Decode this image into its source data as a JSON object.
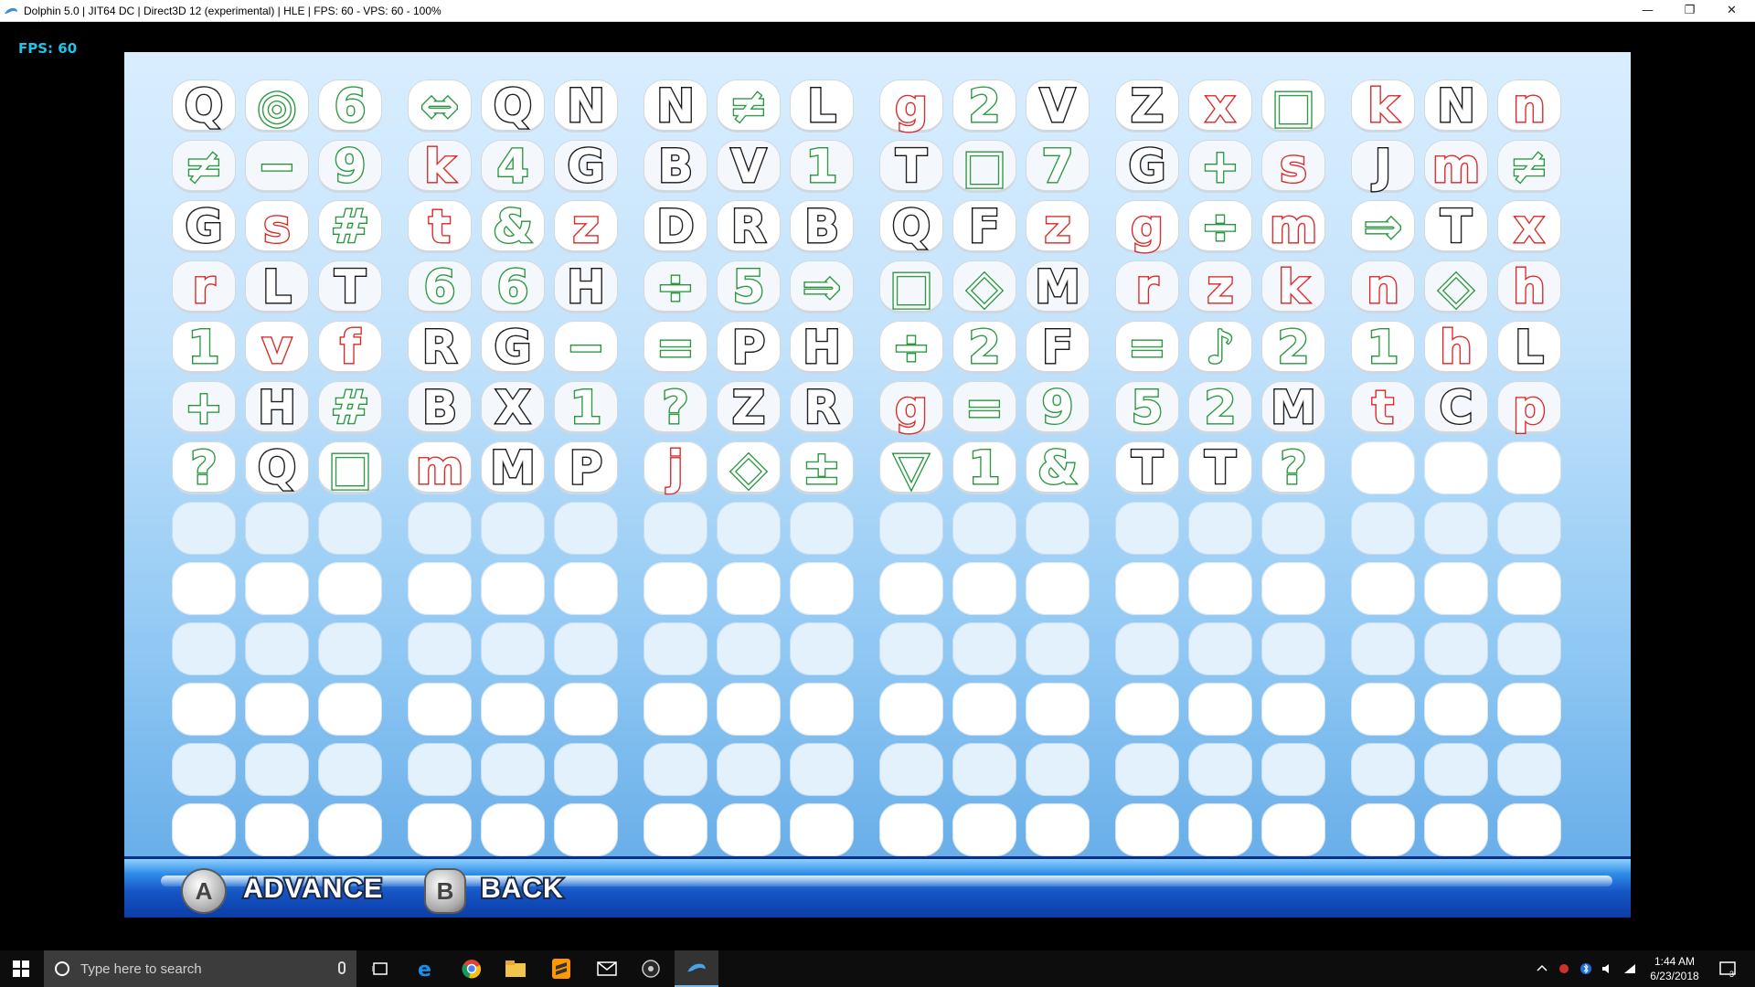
{
  "window": {
    "title": "Dolphin 5.0 | JIT64 DC | Direct3D 12 (experimental) | HLE | FPS: 60 - VPS: 60 - 100%",
    "min_glyph": "—",
    "max_glyph": "❐",
    "close_glyph": "✕"
  },
  "overlay": {
    "fps": "FPS: 60"
  },
  "grid": {
    "rows": [
      [
        [
          "Q",
          "k"
        ],
        [
          "◎",
          "g"
        ],
        [
          "6",
          "g"
        ],
        [
          "⇔",
          "g"
        ],
        [
          "Q",
          "k"
        ],
        [
          "N",
          "k"
        ],
        [
          "N",
          "k"
        ],
        [
          "≠",
          "g"
        ],
        [
          "L",
          "k"
        ],
        [
          "g",
          "r"
        ],
        [
          "2",
          "g"
        ],
        [
          "V",
          "k"
        ],
        [
          "Z",
          "k"
        ],
        [
          "x",
          "r"
        ],
        [
          "□",
          "g"
        ],
        [
          "k",
          "r"
        ],
        [
          "N",
          "k"
        ],
        [
          "n",
          "r"
        ]
      ],
      [
        [
          "≠",
          "g"
        ],
        [
          "−",
          "g"
        ],
        [
          "9",
          "g"
        ],
        [
          "k",
          "r"
        ],
        [
          "4",
          "g"
        ],
        [
          "G",
          "k"
        ],
        [
          "B",
          "k"
        ],
        [
          "V",
          "k"
        ],
        [
          "1",
          "g"
        ],
        [
          "T",
          "k"
        ],
        [
          "□",
          "g"
        ],
        [
          "7",
          "g"
        ],
        [
          "G",
          "k"
        ],
        [
          "+",
          "g"
        ],
        [
          "s",
          "r"
        ],
        [
          "J",
          "k"
        ],
        [
          "m",
          "r"
        ],
        [
          "≠",
          "g"
        ]
      ],
      [
        [
          "G",
          "k"
        ],
        [
          "s",
          "r"
        ],
        [
          "#",
          "g"
        ],
        [
          "t",
          "r"
        ],
        [
          "&",
          "g"
        ],
        [
          "z",
          "r"
        ],
        [
          "D",
          "k"
        ],
        [
          "R",
          "k"
        ],
        [
          "B",
          "k"
        ],
        [
          "Q",
          "k"
        ],
        [
          "F",
          "k"
        ],
        [
          "z",
          "r"
        ],
        [
          "g",
          "r"
        ],
        [
          "÷",
          "g"
        ],
        [
          "m",
          "r"
        ],
        [
          "⇒",
          "g"
        ],
        [
          "T",
          "k"
        ],
        [
          "x",
          "r"
        ]
      ],
      [
        [
          "r",
          "r"
        ],
        [
          "L",
          "k"
        ],
        [
          "T",
          "k"
        ],
        [
          "6",
          "g"
        ],
        [
          "6",
          "g"
        ],
        [
          "H",
          "k"
        ],
        [
          "÷",
          "g"
        ],
        [
          "5",
          "g"
        ],
        [
          "⇒",
          "g"
        ],
        [
          "□",
          "g"
        ],
        [
          "◇",
          "g"
        ],
        [
          "M",
          "k"
        ],
        [
          "r",
          "r"
        ],
        [
          "z",
          "r"
        ],
        [
          "k",
          "r"
        ],
        [
          "n",
          "r"
        ],
        [
          "◇",
          "g"
        ],
        [
          "h",
          "r"
        ]
      ],
      [
        [
          "1",
          "g"
        ],
        [
          "v",
          "r"
        ],
        [
          "f",
          "r"
        ],
        [
          "R",
          "k"
        ],
        [
          "G",
          "k"
        ],
        [
          "−",
          "g"
        ],
        [
          "=",
          "g"
        ],
        [
          "P",
          "k"
        ],
        [
          "H",
          "k"
        ],
        [
          "÷",
          "g"
        ],
        [
          "2",
          "g"
        ],
        [
          "F",
          "k"
        ],
        [
          "=",
          "g"
        ],
        [
          "♪",
          "g"
        ],
        [
          "2",
          "g"
        ],
        [
          "1",
          "g"
        ],
        [
          "h",
          "r"
        ],
        [
          "L",
          "k"
        ]
      ],
      [
        [
          "+",
          "g"
        ],
        [
          "H",
          "k"
        ],
        [
          "#",
          "g"
        ],
        [
          "B",
          "k"
        ],
        [
          "X",
          "k"
        ],
        [
          "1",
          "g"
        ],
        [
          "?",
          "g"
        ],
        [
          "Z",
          "k"
        ],
        [
          "R",
          "k"
        ],
        [
          "g",
          "r"
        ],
        [
          "=",
          "g"
        ],
        [
          "9",
          "g"
        ],
        [
          "5",
          "g"
        ],
        [
          "2",
          "g"
        ],
        [
          "M",
          "k"
        ],
        [
          "t",
          "r"
        ],
        [
          "C",
          "k"
        ],
        [
          "p",
          "r"
        ]
      ],
      [
        [
          "?",
          "g"
        ],
        [
          "Q",
          "k"
        ],
        [
          "□",
          "g"
        ],
        [
          "m",
          "r"
        ],
        [
          "M",
          "k"
        ],
        [
          "P",
          "k"
        ],
        [
          "j",
          "r"
        ],
        [
          "◇",
          "g"
        ],
        [
          "±",
          "g"
        ],
        [
          "▽",
          "g"
        ],
        [
          "1",
          "g"
        ],
        [
          "&",
          "g"
        ],
        [
          "T",
          "k"
        ],
        [
          "T",
          "k"
        ],
        [
          "?",
          "g"
        ],
        [
          "",
          ""
        ],
        [
          "",
          ""
        ],
        [
          "",
          ""
        ]
      ]
    ],
    "total_rows": 13,
    "total_cols": 18
  },
  "controls": {
    "a_button": "A",
    "a_label": "ADVANCE",
    "b_button": "B",
    "b_label": "BACK"
  },
  "taskbar": {
    "search_placeholder": "Type here to search",
    "time": "1:44 AM",
    "date": "6/23/2018",
    "notification_count": "3"
  },
  "colors": {
    "red": "#d81f1f",
    "green": "#23933a",
    "black": "#111111",
    "fps_text": "#21c4e8"
  }
}
